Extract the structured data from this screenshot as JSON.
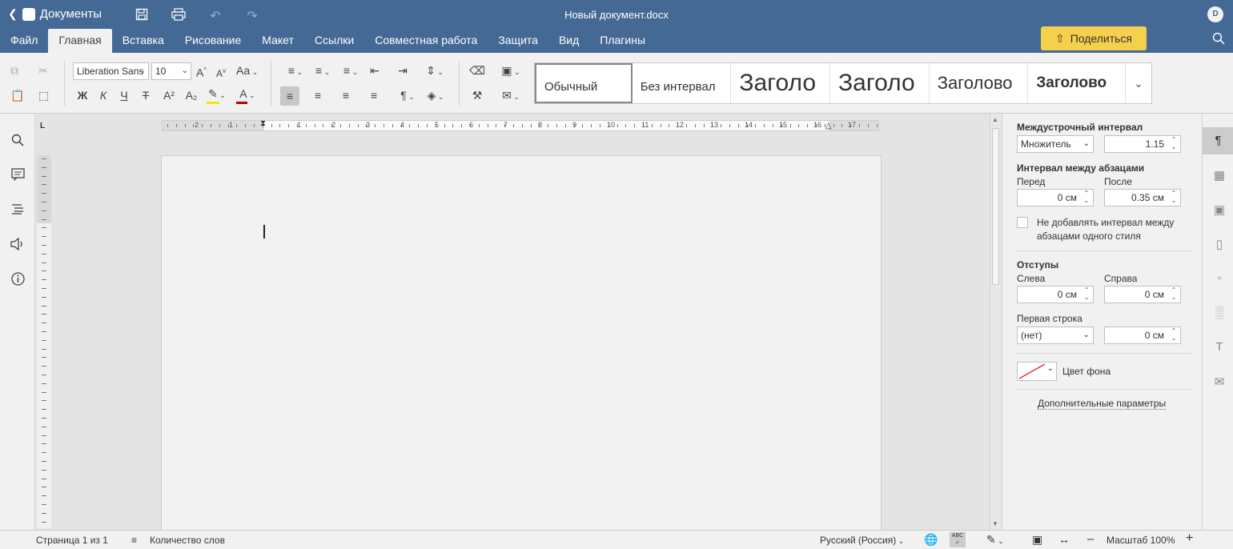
{
  "header": {
    "app_name": "Документы",
    "doc_title": "Новый документ.docx",
    "user_initial": "D",
    "share_label": "Поделиться",
    "quick_access": [
      "save-icon",
      "print-icon",
      "undo-icon",
      "redo-icon"
    ]
  },
  "menu": [
    {
      "label": "Файл",
      "active": false
    },
    {
      "label": "Главная",
      "active": true
    },
    {
      "label": "Вставка",
      "active": false
    },
    {
      "label": "Рисование",
      "active": false
    },
    {
      "label": "Макет",
      "active": false
    },
    {
      "label": "Ссылки",
      "active": false
    },
    {
      "label": "Совместная работа",
      "active": false
    },
    {
      "label": "Защита",
      "active": false
    },
    {
      "label": "Вид",
      "active": false
    },
    {
      "label": "Плагины",
      "active": false
    }
  ],
  "toolbar": {
    "font_name": "Liberation Sans",
    "font_size": "10",
    "bold_label": "Ж",
    "italic_label": "К",
    "underline_label": "Ч",
    "strike_label": "Т",
    "superscript_label": "A²",
    "subscript_label": "A₂",
    "grow_label": "A",
    "shrink_label": "A",
    "case_label": "Aa",
    "font_color_label": "A",
    "highlight_color": "#f5e600",
    "font_color": "#c00000"
  },
  "styles": [
    {
      "label": "Обычный",
      "size": "15px",
      "weight": "normal"
    },
    {
      "label": "Без интервал",
      "size": "15px",
      "weight": "normal"
    },
    {
      "label": "Заголо",
      "size": "30px",
      "weight": "normal"
    },
    {
      "label": "Заголо",
      "size": "30px",
      "weight": "normal"
    },
    {
      "label": "Заголово",
      "size": "22px",
      "weight": "normal"
    },
    {
      "label": "Заголово",
      "size": "19px",
      "weight": "bold"
    }
  ],
  "ruler": {
    "corner_label": "L",
    "h_numbers": [
      "2",
      "1",
      "1",
      "2",
      "3",
      "4",
      "5",
      "6",
      "7",
      "8",
      "9",
      "10",
      "11",
      "12",
      "13",
      "14",
      "15",
      "16",
      "17"
    ]
  },
  "right_panel": {
    "line_spacing_title": "Междустрочный интервал",
    "line_spacing_mode": "Множитель",
    "line_spacing_value": "1.15",
    "para_spacing_title": "Интервал между абзацами",
    "before_label": "Перед",
    "before_value": "0 см",
    "after_label": "После",
    "after_value": "0.35 см",
    "no_space_label_1": "Не добавлять интервал между",
    "no_space_label_2": "абзацами одного стиля",
    "indents_title": "Отступы",
    "left_label": "Слева",
    "left_value": "0 см",
    "right_label": "Справа",
    "right_value": "0 см",
    "first_line_label": "Первая строка",
    "first_line_mode": "(нет)",
    "first_line_value": "0 см",
    "bg_color_label": "Цвет фона",
    "advanced_label": "Дополнительные параметры"
  },
  "right_bar_icons": [
    "paragraph-icon",
    "table-icon",
    "image-icon",
    "header-footer-icon",
    "shape-icon",
    "chart-icon",
    "text-art-icon",
    "mail-merge-icon"
  ],
  "left_bar_icons": [
    "search-icon",
    "comments-icon",
    "navigation-icon",
    "speech-icon",
    "info-icon"
  ],
  "status": {
    "page_info": "Страница 1 из 1",
    "word_count": "Количество слов",
    "language": "Русский (Россия)",
    "zoom": "Масштаб 100%"
  }
}
